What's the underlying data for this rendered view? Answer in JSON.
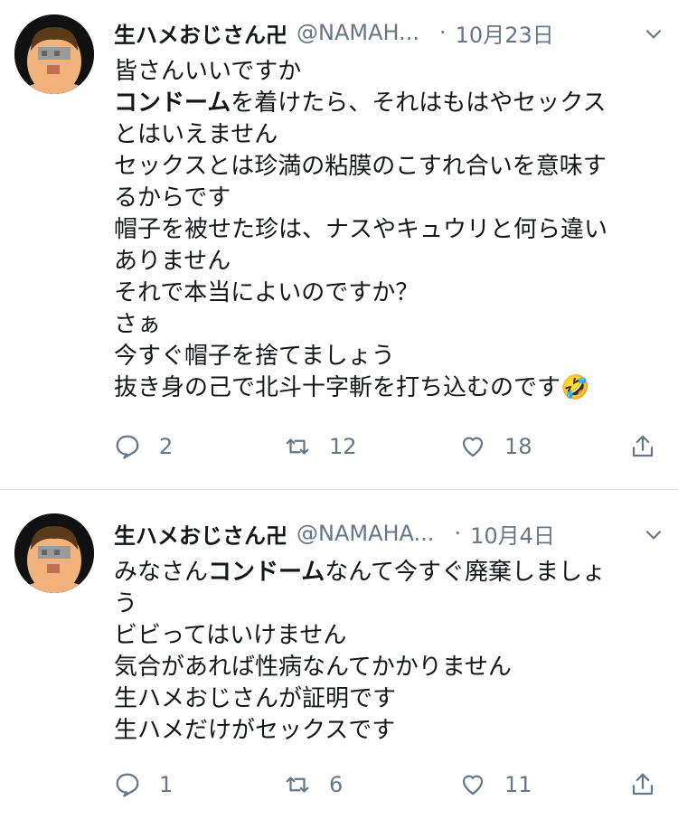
{
  "colors": {
    "text": "#14171a",
    "muted": "#657786",
    "divider": "#e1e8ed"
  },
  "icons": {
    "reply": "reply-icon",
    "retweet": "retweet-icon",
    "like": "heart-icon",
    "share": "share-icon",
    "menu": "chevron-down-icon"
  },
  "tweets": [
    {
      "name": "生ハメおじさん卍",
      "handle": "@NAMAH...",
      "dot": "·",
      "date": "10月23日",
      "lines": [
        [
          {
            "t": "皆さんいいですか"
          }
        ],
        [
          {
            "t": "コンドーム",
            "b": true
          },
          {
            "t": "を着けたら、それはもはやセックス"
          }
        ],
        [
          {
            "t": "とはいえません"
          }
        ],
        [
          {
            "t": "セックスとは珍満の粘膜のこすれ合いを意味す"
          }
        ],
        [
          {
            "t": "るからです"
          }
        ],
        [
          {
            "t": "帽子を被せた珍は、ナスやキュウリと何ら違い"
          }
        ],
        [
          {
            "t": "ありません"
          }
        ],
        [
          {
            "t": "それで本当によいのですか？"
          }
        ],
        [
          {
            "t": "さぁ"
          }
        ],
        [
          {
            "t": "今すぐ帽子を捨てましょう"
          }
        ],
        [
          {
            "t": "抜き身の己で北斗十字斬を打ち込むのです"
          },
          {
            "t": "🤣",
            "emoji": true
          }
        ]
      ],
      "replies": "2",
      "retweets": "12",
      "likes": "18"
    },
    {
      "name": "生ハメおじさん卍",
      "handle": "@NAMAHA...",
      "dot": "·",
      "date": "10月4日",
      "lines": [
        [
          {
            "t": "みなさん"
          },
          {
            "t": "コンドーム",
            "b": true
          },
          {
            "t": "なんて今すぐ廃棄しましょ"
          }
        ],
        [
          {
            "t": "う"
          }
        ],
        [
          {
            "t": "ビビってはいけません"
          }
        ],
        [
          {
            "t": "気合があれば性病なんてかかりません"
          }
        ],
        [
          {
            "t": "生ハメおじさんが証明です"
          }
        ],
        [
          {
            "t": "生ハメだけがセックスです"
          }
        ]
      ],
      "replies": "1",
      "retweets": "6",
      "likes": "11"
    }
  ]
}
